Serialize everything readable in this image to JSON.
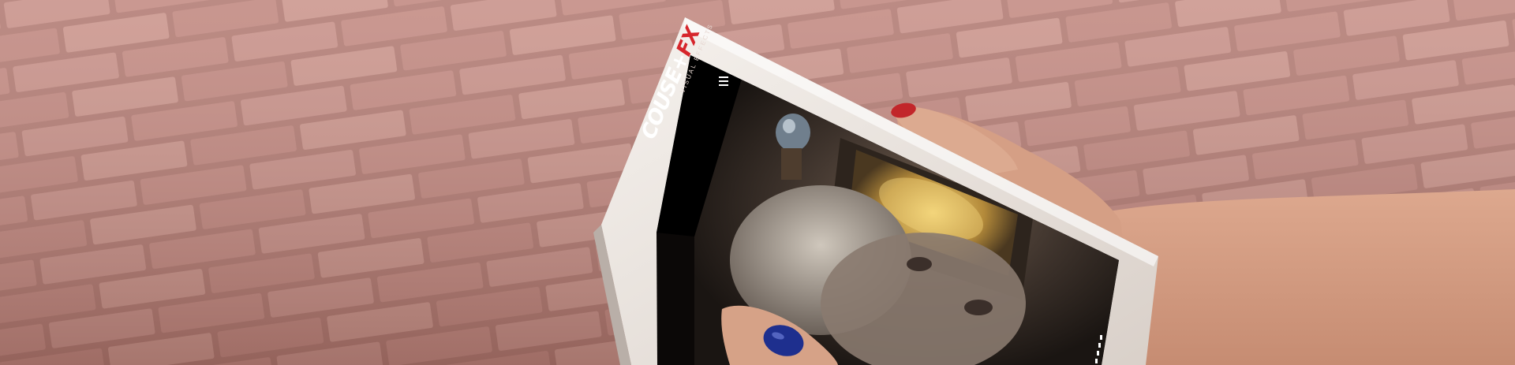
{
  "scene": {
    "description_tag": "photo",
    "colors": {
      "pavement": "#b9827a",
      "tablet_frame": "#ece6e1",
      "screen_black": "#0b0807",
      "brand_accent": "#d6262c",
      "nail_polish": "#1e2f8e",
      "skin": "#d39c82"
    }
  },
  "tablet": {
    "site": {
      "brand_main": "COUSE+",
      "brand_accent": "FX",
      "brand_tagline": "VISUAL EFFECTS",
      "menu_icon": "hamburger-menu-icon"
    }
  }
}
